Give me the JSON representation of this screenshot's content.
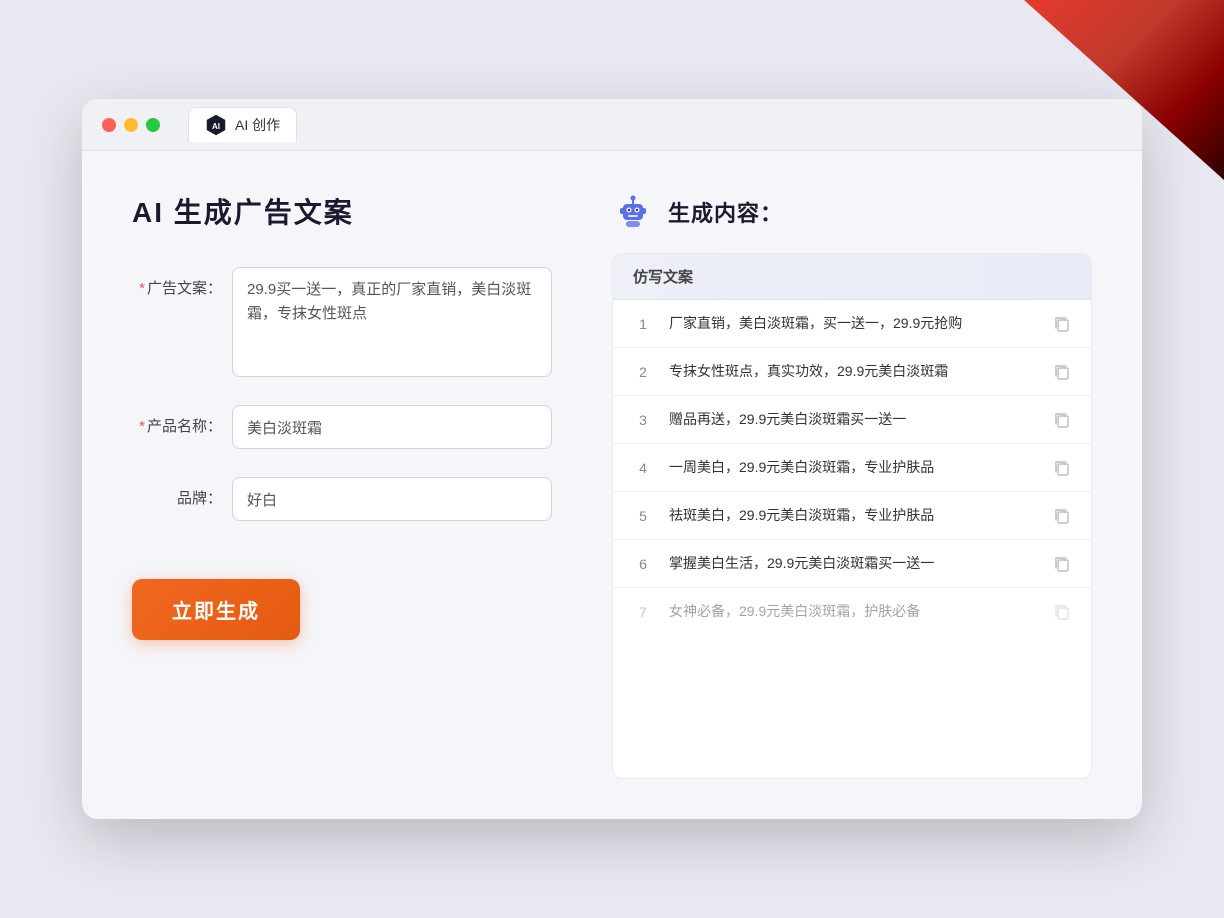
{
  "window": {
    "tab_label": "AI 创作"
  },
  "left_panel": {
    "title": "AI 生成广告文案",
    "ad_label": "广告文案：",
    "ad_required": "*",
    "ad_value": "29.9买一送一，真正的厂家直销，美白淡斑霜，专抹女性斑点",
    "product_label": "产品名称：",
    "product_required": "*",
    "product_value": "美白淡斑霜",
    "brand_label": "品牌：",
    "brand_value": "好白",
    "generate_btn": "立即生成"
  },
  "right_panel": {
    "title": "生成内容：",
    "table_header": "仿写文案",
    "rows": [
      {
        "index": "1",
        "text": "厂家直销，美白淡斑霜，买一送一，29.9元抢购",
        "muted": false
      },
      {
        "index": "2",
        "text": "专抹女性斑点，真实功效，29.9元美白淡斑霜",
        "muted": false
      },
      {
        "index": "3",
        "text": "赠品再送，29.9元美白淡斑霜买一送一",
        "muted": false
      },
      {
        "index": "4",
        "text": "一周美白，29.9元美白淡斑霜，专业护肤品",
        "muted": false
      },
      {
        "index": "5",
        "text": "祛斑美白，29.9元美白淡斑霜，专业护肤品",
        "muted": false
      },
      {
        "index": "6",
        "text": "掌握美白生活，29.9元美白淡斑霜买一送一",
        "muted": false
      },
      {
        "index": "7",
        "text": "女神必备，29.9元美白淡斑霜，护肤必备",
        "muted": true
      }
    ]
  }
}
